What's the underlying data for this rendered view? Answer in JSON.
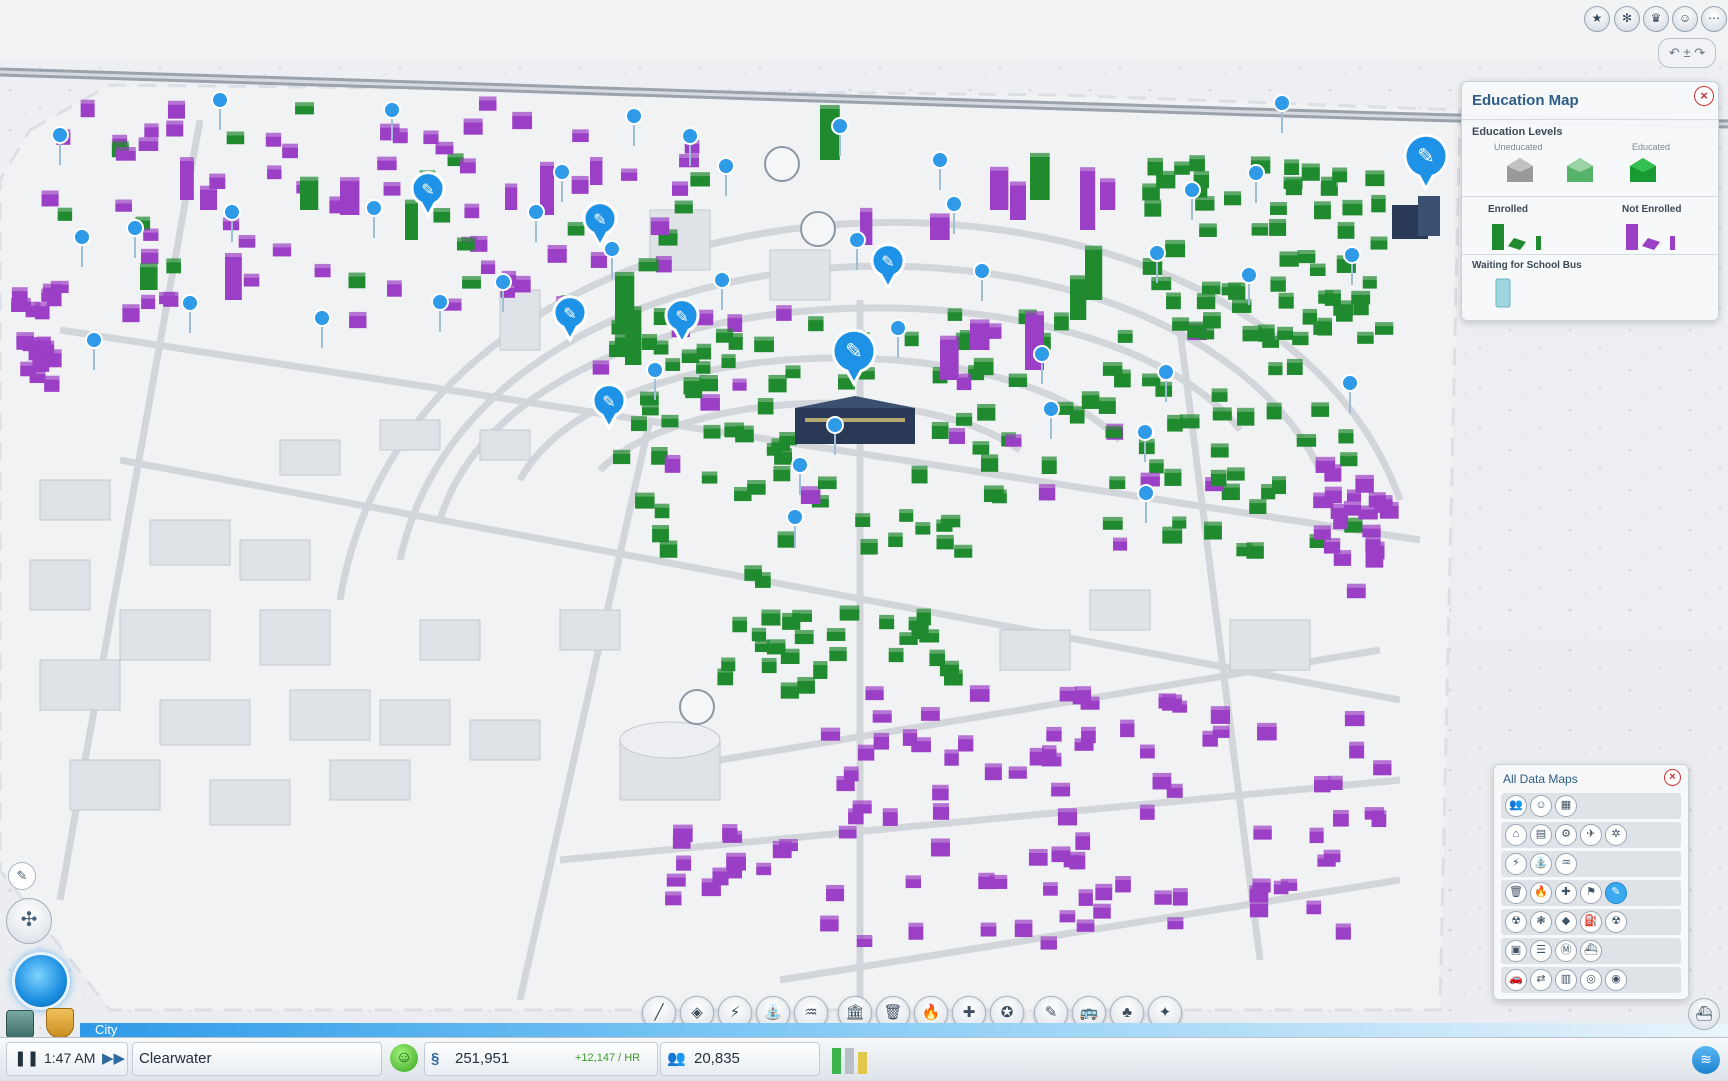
{
  "colors": {
    "accent": "#2e9ae8",
    "enrolled": "#1f8a2e",
    "not_enrolled": "#9b3fc6",
    "school_bus": "#9fd6e0",
    "uneducated": "#9a9a9a",
    "educated": "#1da336"
  },
  "education_map": {
    "title": "Education Map",
    "levels_heading": "Education Levels",
    "uneducated_label": "Uneducated",
    "educated_label": "Educated",
    "enrolled_label": "Enrolled",
    "not_enrolled_label": "Not Enrolled",
    "bus_label": "Waiting for School Bus",
    "close_icon": "close-icon"
  },
  "all_data_maps": {
    "title": "All Data Maps",
    "rows": [
      [
        "people-icon",
        "happiness-icon",
        "land-value-icon"
      ],
      [
        "residential-icon",
        "commercial-icon",
        "industrial-icon",
        "tourism-icon",
        "gear-icon"
      ],
      [
        "power-icon",
        "water-icon",
        "sewage-icon"
      ],
      [
        "garbage-icon",
        "fire-icon",
        "health-icon",
        "crime-icon",
        "education-icon"
      ],
      [
        "pollution-icon",
        "wind-icon",
        "ore-icon",
        "oil-icon",
        "radiation-icon"
      ],
      [
        "bus-icon",
        "rail-icon",
        "subway-icon",
        "ferry-icon"
      ],
      [
        "car-icon",
        "trade-icon",
        "storage-icon",
        "target-icon",
        "camera-icon"
      ]
    ]
  },
  "bottom_bar": {
    "mode_label": "City",
    "time": "1:47 AM",
    "city_name": "Clearwater",
    "money": "251,951",
    "income": "+12,147 / HR",
    "population": "20,835"
  },
  "toolbar": [
    "road-icon",
    "zone-icon",
    "power-icon",
    "water-icon",
    "sewage-icon",
    "city-hall-icon",
    "garbage-icon",
    "fire-icon",
    "health-icon",
    "police-icon",
    "education-icon",
    "transport-icon",
    "parks-icon",
    "disaster-icon"
  ],
  "top_right_icons": [
    "achievement-icon",
    "region-icon",
    "trophy-icon",
    "friends-icon",
    "menu-icon"
  ]
}
